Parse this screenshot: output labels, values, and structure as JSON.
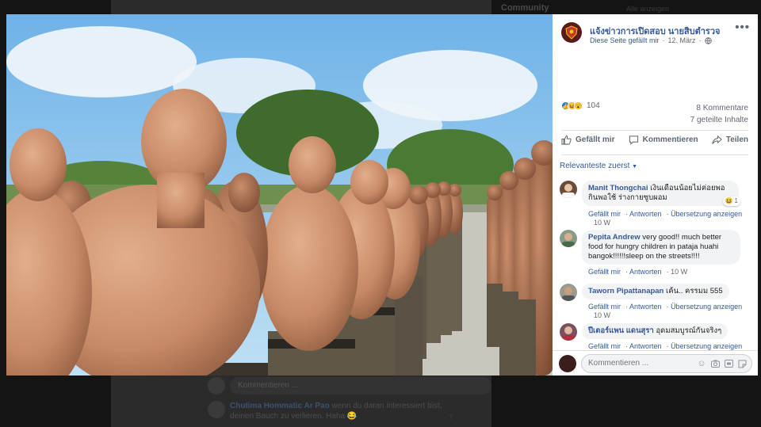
{
  "background": {
    "side_title": "Community",
    "side_link": "Alle anzeigen",
    "comment_placeholder": "Kommentieren ...",
    "bg_comment": {
      "name": "Chutima Hommatic Ar Pao",
      "text": "wenn du daran interessiert bist, deinen Bauch zu verlieren. Haha 😂",
      "reactions": "7"
    }
  },
  "post": {
    "page_name": "แจ้งข่าวการเปิดสอบ นายสิบตำรวจ",
    "page_sub": "Diese Seite gefällt mir",
    "date": "12. März",
    "reaction_count": "104",
    "comments_count": "8 Kommentare",
    "shares_count": "7 geteilte Inhalte",
    "actions": {
      "like": "Gefällt mir",
      "comment": "Kommentieren",
      "share": "Teilen"
    },
    "sort_label": "Relevanteste zuerst"
  },
  "comments": [
    {
      "name": "Manit Thongchai",
      "text": "เงินเดือนน้อยไม่ค่อยพอกินพอใช้ ร่างกายซูบผอม",
      "badge": "1",
      "time": "10 W",
      "has_translate": true
    },
    {
      "name": "Pepita Andrew",
      "text": "very good!! much better food for hungry children in pataja huahi bangok!!!!!!sleep on the streets!!!!",
      "time": "10 W",
      "has_translate": false
    },
    {
      "name": "Taworn Pipattanapan",
      "text": "เค้น.. ครรมม 555",
      "time": "10 W",
      "has_translate": true
    },
    {
      "name": "ปีเตอร์แพน แดนสุรา",
      "text": "อุดมสมบูรณ์กันจริงๆ",
      "time": "",
      "has_translate": true
    }
  ],
  "comment_actions": {
    "like": "Gefällt mir",
    "reply": "Antworten",
    "translate": "Übersetzung anzeigen"
  },
  "composer": {
    "placeholder": "Kommentieren ..."
  },
  "colors": {
    "link_blue": "#365899",
    "like_blue": "#1877f2",
    "overlay": "#141414"
  },
  "icons": [
    "page-crest-icon",
    "globe-icon",
    "more-options-icon",
    "like-reaction-icon",
    "haha-reaction-icon",
    "wow-reaction-icon",
    "thumbs-up-icon",
    "comment-bubble-icon",
    "share-arrow-icon",
    "caret-down-icon",
    "emoji-icon",
    "camera-icon",
    "gif-icon",
    "sticker-icon"
  ]
}
